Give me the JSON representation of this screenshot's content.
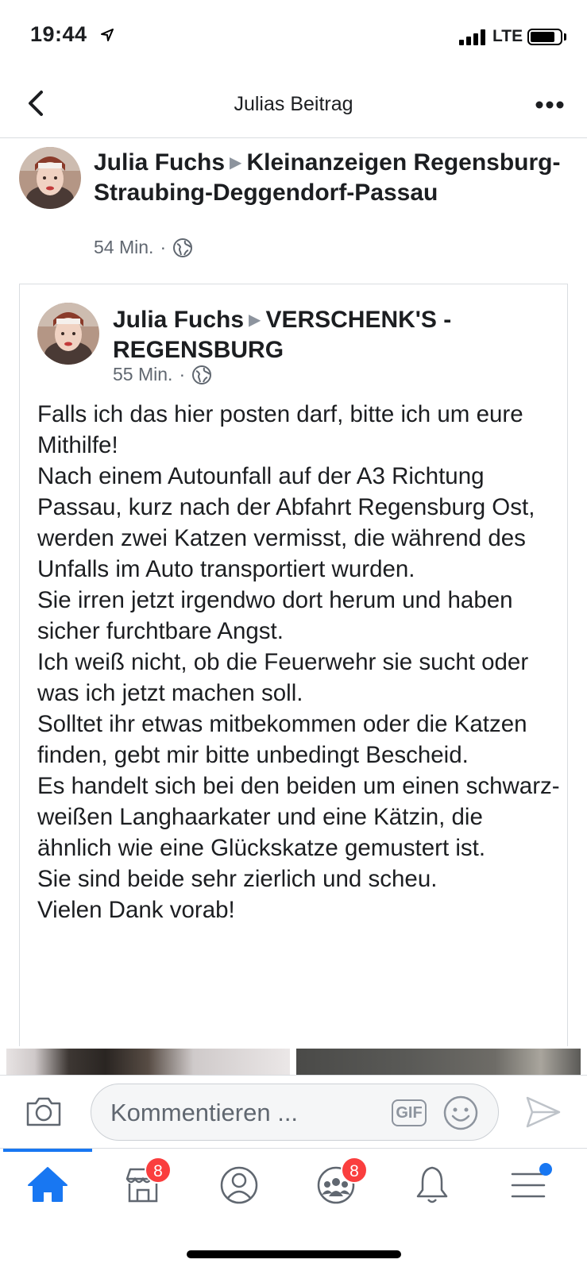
{
  "status_bar": {
    "time": "19:44",
    "network": "LTE",
    "icons": [
      "location-arrow-icon",
      "signal-bars-icon",
      "battery-icon"
    ]
  },
  "nav": {
    "title": "Julias Beitrag",
    "back_icon": "chevron-left-icon",
    "more_icon": "more-dots-icon"
  },
  "post": {
    "author": "Julia Fuchs",
    "separator": "▶",
    "group": "Kleinanzeigen Regensburg-Straubing-Deggendorf-Passau",
    "time": "54 Min.",
    "meta_dot": "·",
    "privacy_icon": "globe-icon"
  },
  "shared_post": {
    "author": "Julia Fuchs",
    "separator": "▶",
    "group": "VERSCHENK'S - REGENSBURG",
    "time": "55 Min.",
    "meta_dot": "·",
    "privacy_icon": "globe-icon",
    "body_lines": [
      "Falls ich das hier posten darf, bitte ich um eure Mithilfe!",
      "Nach einem Autounfall auf der A3 Richtung Passau, kurz nach der Abfahrt Regensburg Ost, werden zwei Katzen vermisst, die während des Unfalls im Auto transportiert wurden.",
      "Sie irren jetzt irgendwo dort herum und haben sicher furchtbare Angst.",
      "Ich weiß nicht, ob die Feuerwehr sie sucht oder was ich jetzt machen soll.",
      "Solltet ihr etwas mitbekommen oder die Katzen finden, gebt mir bitte unbedingt Bescheid.",
      "Es handelt sich bei den beiden um einen schwarz-weißen Langhaarkater und eine Kätzin, die ähnlich wie eine Glückskatze gemustert ist.",
      "Sie sind beide sehr zierlich und scheu.",
      "Vielen Dank vorab!"
    ]
  },
  "comment_bar": {
    "placeholder": "Kommentieren ...",
    "gif_label": "GIF",
    "icons": [
      "camera-icon",
      "emoji-icon",
      "send-icon"
    ]
  },
  "tab_bar": {
    "tabs": [
      {
        "name": "home",
        "icon": "home-icon",
        "active": true,
        "badge": ""
      },
      {
        "name": "marketplace",
        "icon": "marketplace-icon",
        "active": false,
        "badge": "8"
      },
      {
        "name": "profile",
        "icon": "profile-icon",
        "active": false,
        "badge": ""
      },
      {
        "name": "groups",
        "icon": "groups-icon",
        "active": false,
        "badge": "8"
      },
      {
        "name": "notifications",
        "icon": "bell-icon",
        "active": false,
        "badge": ""
      },
      {
        "name": "menu",
        "icon": "menu-icon",
        "active": false,
        "badge": ""
      }
    ],
    "accent": "#1877f2",
    "badge_color": "#fa3e3e"
  }
}
